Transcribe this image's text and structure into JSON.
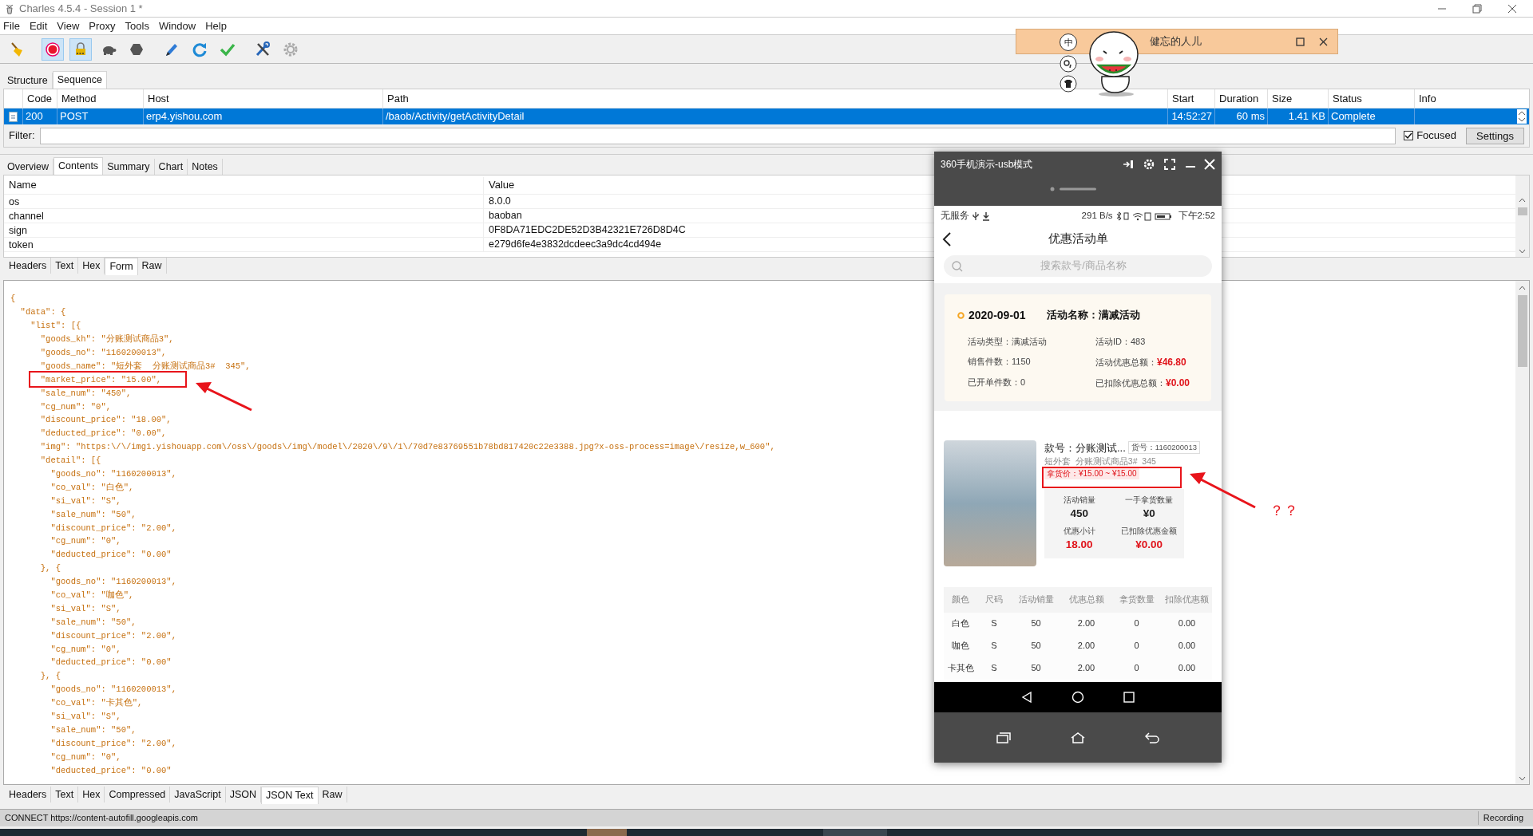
{
  "window": {
    "title": "Charles 4.5.4 - Session 1 *"
  },
  "menu": [
    "File",
    "Edit",
    "View",
    "Proxy",
    "Tools",
    "Window",
    "Help"
  ],
  "toolbar": [
    {
      "kind": "broom",
      "on": false
    },
    {
      "kind": "record",
      "on": true
    },
    {
      "kind": "throttle",
      "on": true
    },
    {
      "kind": "turtle",
      "on": false
    },
    {
      "kind": "stop",
      "on": false
    },
    {
      "kind": "pen",
      "on": false
    },
    {
      "kind": "refresh",
      "on": false
    },
    {
      "kind": "check",
      "on": false
    },
    {
      "kind": "tools",
      "on": false
    },
    {
      "kind": "gear",
      "on": false
    }
  ],
  "view_tabs": [
    {
      "label": "Structure",
      "selected": false
    },
    {
      "label": "Sequence",
      "selected": true
    }
  ],
  "requests": {
    "columns": [
      "Code",
      "Method",
      "Host",
      "Path",
      "Start",
      "Duration",
      "Size",
      "Status",
      "Info"
    ],
    "rows": [
      {
        "selected": true,
        "cells": [
          "200",
          "POST",
          "erp4.yishou.com",
          "/baob/Activity/getActivityDetail",
          "14:52:27",
          "60 ms",
          "1.41 KB",
          "Complete"
        ]
      }
    ]
  },
  "filter": {
    "label": "Filter:",
    "focused": {
      "label": "Focused",
      "checked": true
    },
    "settings": "Settings"
  },
  "detail_tabs": [
    {
      "label": "Overview",
      "selected": false
    },
    {
      "label": "Contents",
      "selected": true
    },
    {
      "label": "Summary",
      "selected": false
    },
    {
      "label": "Chart",
      "selected": false
    },
    {
      "label": "Notes",
      "selected": false
    }
  ],
  "form": {
    "columns": [
      "Name",
      "Value"
    ],
    "rows": [
      [
        "os",
        "8.0.0"
      ],
      [
        "channel",
        "baoban"
      ],
      [
        "sign",
        "0F8DA71EDC2DE52D3B42321E726D8D4C"
      ],
      [
        "token",
        "e279d6fe4e3832dcdeec3a9dc4cd494e"
      ]
    ]
  },
  "request_tabs": [
    {
      "label": "Headers",
      "selected": false
    },
    {
      "label": "Text",
      "selected": false
    },
    {
      "label": "Hex",
      "selected": false
    },
    {
      "label": "Form",
      "selected": true
    },
    {
      "label": "Raw",
      "selected": false
    }
  ],
  "json_lines": [
    "{",
    "  \"data\": {",
    "    \"list\": [{",
    "      \"goods_kh\": \"分账测试商品3\",",
    "      \"goods_no\": \"1160200013\",",
    "      \"goods_name\": \"短外套  分账测试商品3#  345\",",
    "      \"market_price\": \"15.00\",",
    "      \"sale_num\": \"450\",",
    "      \"cg_num\": \"0\",",
    "      \"discount_price\": \"18.00\",",
    "      \"deducted_price\": \"0.00\",",
    "      \"img\": \"https:\\/\\/img1.yishouapp.com\\/oss\\/goods\\/img\\/model\\/2020\\/9\\/1\\/70d7e83769551b78bd817420c22e3388.jpg?x-oss-process=image\\/resize,w_600\",",
    "      \"detail\": [{",
    "        \"goods_no\": \"1160200013\",",
    "        \"co_val\": \"白色\",",
    "        \"si_val\": \"S\",",
    "        \"sale_num\": \"50\",",
    "        \"discount_price\": \"2.00\",",
    "        \"cg_num\": \"0\",",
    "        \"deducted_price\": \"0.00\"",
    "      }, {",
    "        \"goods_no\": \"1160200013\",",
    "        \"co_val\": \"咖色\",",
    "        \"si_val\": \"S\",",
    "        \"sale_num\": \"50\",",
    "        \"discount_price\": \"2.00\",",
    "        \"cg_num\": \"0\",",
    "        \"deducted_price\": \"0.00\"",
    "      }, {",
    "        \"goods_no\": \"1160200013\",",
    "        \"co_val\": \"卡其色\",",
    "        \"si_val\": \"S\",",
    "        \"sale_num\": \"50\",",
    "        \"discount_price\": \"2.00\",",
    "        \"cg_num\": \"0\",",
    "        \"deducted_price\": \"0.00\""
  ],
  "response_tabs": [
    {
      "label": "Headers",
      "selected": false
    },
    {
      "label": "Text",
      "selected": false
    },
    {
      "label": "Hex",
      "selected": false
    },
    {
      "label": "Compressed",
      "selected": false
    },
    {
      "label": "JavaScript",
      "selected": false
    },
    {
      "label": "JSON",
      "selected": false
    },
    {
      "label": "JSON Text",
      "selected": true
    },
    {
      "label": "Raw",
      "selected": false
    }
  ],
  "status_bar": {
    "text": "CONNECT https://content-autofill.googleapis.com",
    "recording": "Recording"
  },
  "floating_widget": {
    "badge": "中",
    "title": "健忘的人儿"
  },
  "phone": {
    "title": "360手机演示-usb模式",
    "status_left": "无服务",
    "status_rate": "291 B/s",
    "status_time": "下午2:52",
    "page_title": "优惠活动单",
    "search_placeholder": "搜索款号/商品名称",
    "activity": {
      "date": "2020-09-01",
      "name": "活动名称：满减活动",
      "fields": [
        {
          "label": "活动类型：",
          "value": "满减活动",
          "highlight": false
        },
        {
          "label": "活动ID：",
          "value": "483",
          "highlight": false
        },
        {
          "label": "销售件数：",
          "value": "1150",
          "highlight": false
        },
        {
          "label": "活动优惠总额：",
          "value": "¥46.80",
          "highlight": true
        },
        {
          "label": "已开单件数：",
          "value": "0",
          "highlight": false
        },
        {
          "label": "已扣除优惠总额：",
          "value": "¥0.00",
          "highlight": true
        }
      ]
    },
    "product": {
      "title": "款号：分账测试...",
      "goods_no": "货号：1160200013",
      "subtitle": "短外套  分账测试商品3#  345",
      "price": "拿货价：¥15.00 ~ ¥15.00",
      "stats": [
        {
          "label": "活动销量",
          "value": "450",
          "highlight": false
        },
        {
          "label": "一手拿货数量",
          "value": "¥0",
          "highlight": false
        },
        {
          "label": "优惠小计",
          "value": "18.00",
          "highlight": true
        },
        {
          "label": "已扣除优惠金额",
          "value": "¥0.00",
          "highlight": true
        }
      ]
    },
    "table": {
      "columns": [
        "颜色",
        "尺码",
        "活动销量",
        "优惠总额",
        "拿货数量",
        "扣除优惠额"
      ],
      "rows": [
        [
          "白色",
          "S",
          "50",
          "2.00",
          "0",
          "0.00"
        ],
        [
          "咖色",
          "S",
          "50",
          "2.00",
          "0",
          "0.00"
        ],
        [
          "卡其色",
          "S",
          "50",
          "2.00",
          "0",
          "0.00"
        ]
      ]
    }
  },
  "annotations": {
    "question": "？？"
  }
}
